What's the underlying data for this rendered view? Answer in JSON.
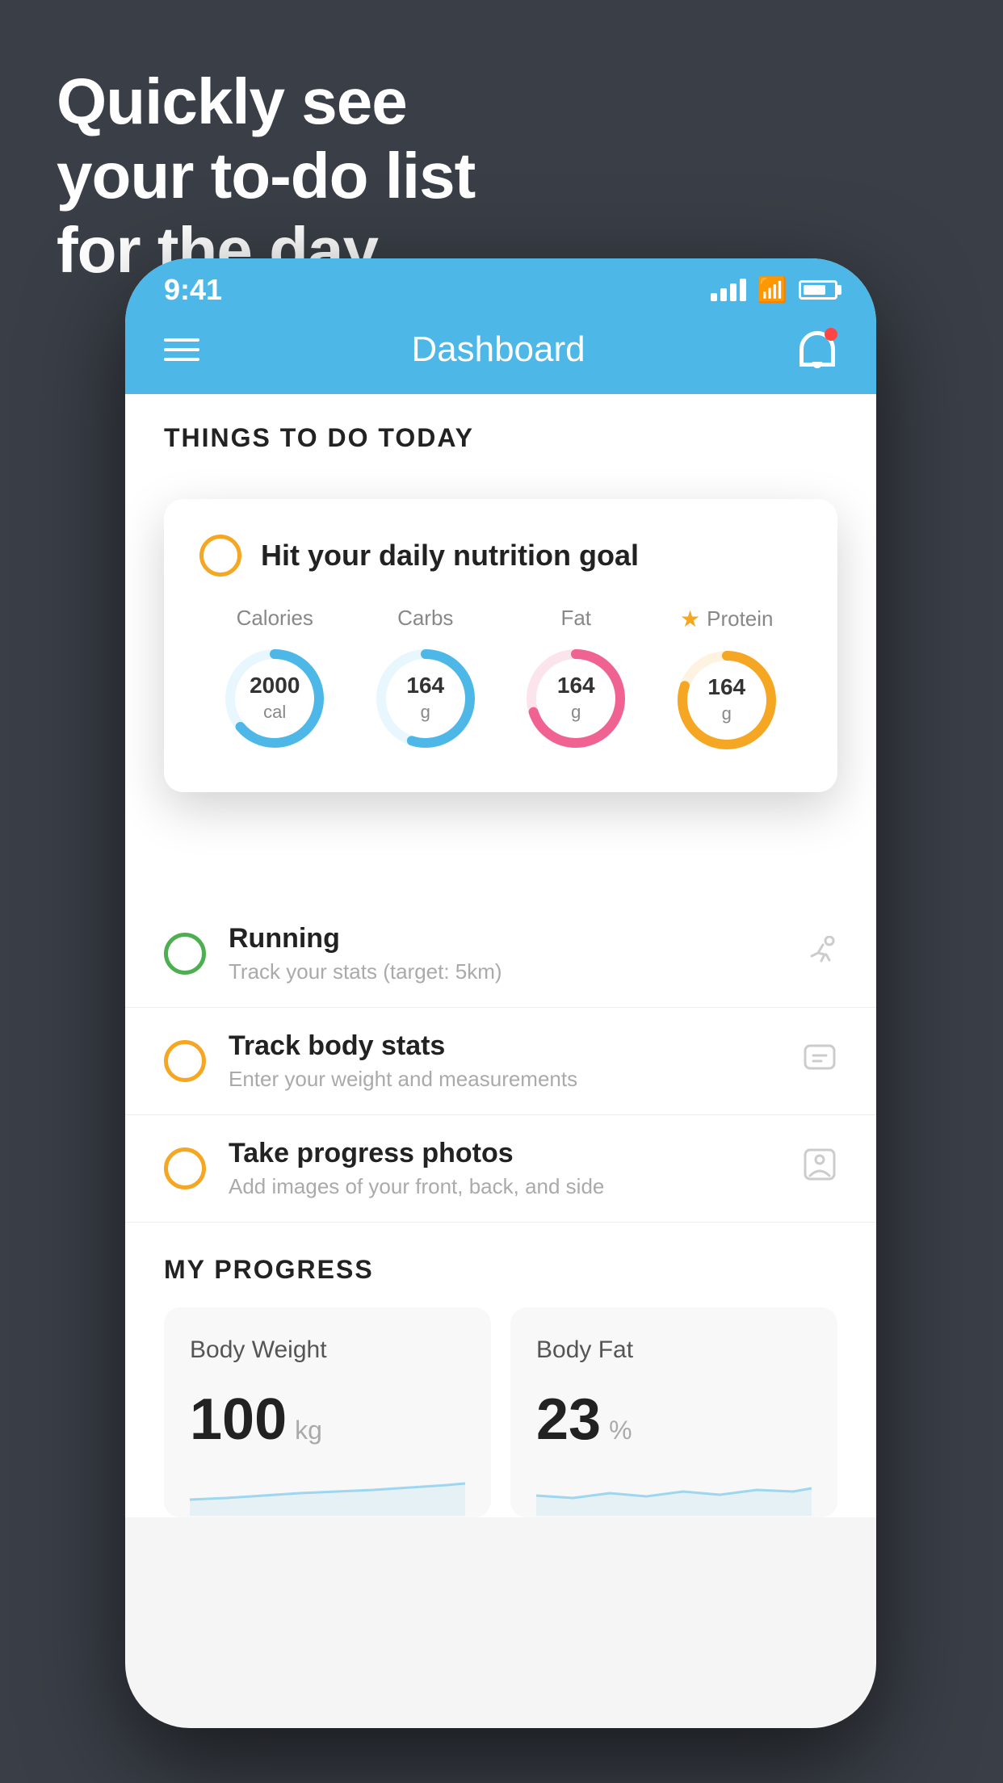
{
  "hero": {
    "headline_line1": "Quickly see",
    "headline_line2": "your to-do list",
    "headline_line3": "for the day."
  },
  "status_bar": {
    "time": "9:41"
  },
  "nav": {
    "title": "Dashboard"
  },
  "things_header": "THINGS TO DO TODAY",
  "floating_card": {
    "title": "Hit your daily nutrition goal",
    "nutrients": [
      {
        "label": "Calories",
        "value": "2000",
        "unit": "cal",
        "color": "#4db8e8",
        "pct": 65
      },
      {
        "label": "Carbs",
        "value": "164",
        "unit": "g",
        "color": "#4db8e8",
        "pct": 55
      },
      {
        "label": "Fat",
        "value": "164",
        "unit": "g",
        "color": "#f06292",
        "pct": 70
      },
      {
        "label": "Protein",
        "value": "164",
        "unit": "g",
        "color": "#f5a623",
        "pct": 80,
        "star": true
      }
    ]
  },
  "todo_items": [
    {
      "title": "Running",
      "subtitle": "Track your stats (target: 5km)",
      "circle_color": "green",
      "icon": "👟"
    },
    {
      "title": "Track body stats",
      "subtitle": "Enter your weight and measurements",
      "circle_color": "yellow",
      "icon": "⚖"
    },
    {
      "title": "Take progress photos",
      "subtitle": "Add images of your front, back, and side",
      "circle_color": "yellow",
      "icon": "👤"
    }
  ],
  "progress": {
    "header": "MY PROGRESS",
    "cards": [
      {
        "title": "Body Weight",
        "value": "100",
        "unit": "kg"
      },
      {
        "title": "Body Fat",
        "value": "23",
        "unit": "%"
      }
    ]
  }
}
